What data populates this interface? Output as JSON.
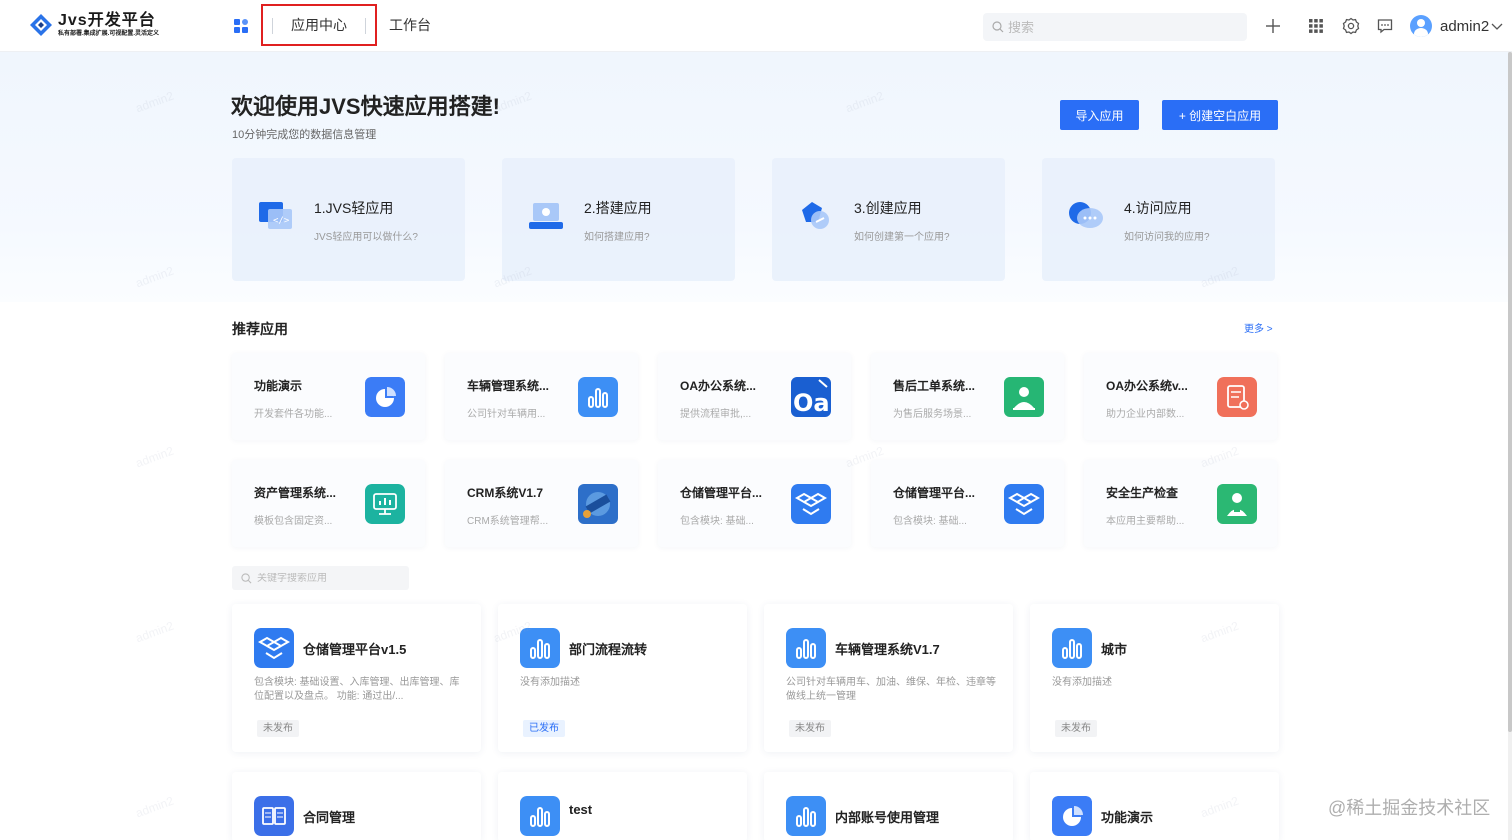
{
  "header": {
    "logo_title": "Jvs开发平台",
    "logo_subtitle": "私有部署.集成扩展.可视配置.灵活定义",
    "tabs": [
      {
        "label": "应用中心"
      },
      {
        "label": "工作台"
      }
    ],
    "search_placeholder": "搜索",
    "username": "admin2",
    "icons": [
      "add-icon",
      "grid-icon",
      "gear-icon",
      "message-icon"
    ]
  },
  "hero": {
    "title": "欢迎使用JVS快速应用搭建!",
    "subtitle": "10分钟完成您的数据信息管理",
    "import_label": "导入应用",
    "create_label": "+ 创建空白应用",
    "guides": [
      {
        "title": "1.JVS轻应用",
        "desc": "JVS轻应用可以做什么?"
      },
      {
        "title": "2.搭建应用",
        "desc": "如何搭建应用?"
      },
      {
        "title": "3.创建应用",
        "desc": "如何创建第一个应用?"
      },
      {
        "title": "4.访问应用",
        "desc": "如何访问我的应用?"
      }
    ]
  },
  "recommended": {
    "title": "推荐应用",
    "more": "更多 >",
    "items": [
      {
        "title": "功能演示",
        "desc": "开发套件各功能...",
        "icon": "pie-chart-icon",
        "color": "#3b7cf6"
      },
      {
        "title": "车辆管理系统...",
        "desc": "公司针对车辆用...",
        "icon": "bar-chart-icon",
        "color": "#3d8ff5"
      },
      {
        "title": "OA办公系统...",
        "desc": "提供流程审批,...",
        "icon": "oa-logo-icon",
        "color": "#1a5fd1"
      },
      {
        "title": "售后工单系统...",
        "desc": "为售后服务场景...",
        "icon": "worker-icon",
        "color": "#26b674"
      },
      {
        "title": "OA办公系统v...",
        "desc": "助力企业内部数...",
        "icon": "document-icon",
        "color": "#f0705a"
      },
      {
        "title": "资产管理系统...",
        "desc": "模板包含固定资...",
        "icon": "monitor-chart-icon",
        "color": "#1cb3a0"
      },
      {
        "title": "CRM系统V1.7",
        "desc": "CRM系统管理帮...",
        "icon": "crm-image-icon",
        "color": "#2d6fc9"
      },
      {
        "title": "仓储管理平台...",
        "desc": "包含模块: 基础...",
        "icon": "dropbox-icon",
        "color": "#2f7bf0"
      },
      {
        "title": "仓储管理平台...",
        "desc": "包含模块: 基础...",
        "icon": "dropbox-icon",
        "color": "#2f7bf0"
      },
      {
        "title": "安全生产检查",
        "desc": "本应用主要帮助...",
        "icon": "inspector-icon",
        "color": "#2bb873"
      }
    ]
  },
  "filter_placeholder": "关键字搜索应用",
  "apps": [
    {
      "title": "仓储管理平台v1.5",
      "desc": "包含模块: 基础设置、入库管理、出库管理、库位配置以及盘点。 功能: 通过出/...",
      "status": "未发布",
      "published": false,
      "icon": "dropbox-icon",
      "color": "#2f7bf0"
    },
    {
      "title": "部门流程流转",
      "desc": "没有添加描述",
      "status": "已发布",
      "published": true,
      "icon": "bar-chart-icon",
      "color": "#3d8ff5"
    },
    {
      "title": "车辆管理系统V1.7",
      "desc": "公司针对车辆用车、加油、维保、年检、违章等做线上统一管理",
      "status": "未发布",
      "published": false,
      "icon": "bar-chart-icon",
      "color": "#3d8ff5"
    },
    {
      "title": "城市",
      "desc": "没有添加描述",
      "status": "未发布",
      "published": false,
      "icon": "bar-chart-icon",
      "color": "#3d8ff5"
    },
    {
      "title": "合同管理",
      "desc": "",
      "icon": "book-icon",
      "color": "#3b6fe8"
    },
    {
      "title": "test",
      "desc": "",
      "icon": "bar-chart-icon",
      "color": "#3d8ff5"
    },
    {
      "title": "内部账号使用管理",
      "desc": "",
      "icon": "bar-chart-icon",
      "color": "#3d8ff5"
    },
    {
      "title": "功能演示",
      "desc": "",
      "icon": "pie-chart-icon",
      "color": "#3b7cf6"
    }
  ],
  "watermark": "admin2",
  "credit": "@稀土掘金技术社区"
}
